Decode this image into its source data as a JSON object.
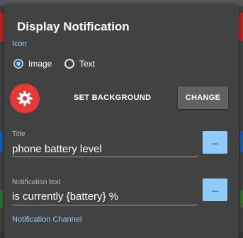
{
  "dialog": {
    "title": "Display Notification",
    "icon_section_label": "Icon",
    "icon_options": [
      {
        "label": "Image",
        "selected": true
      },
      {
        "label": "Text",
        "selected": false
      }
    ],
    "icon_image": "gear-icon",
    "set_background_label": "SET BACKGROUND",
    "change_label": "CHANGE",
    "title_field": {
      "label": "Title",
      "value": "phone battery level"
    },
    "text_field": {
      "label": "Notification text",
      "value": "is currently {battery} %"
    },
    "dots_label": "...",
    "channel_label": "Notification Channel"
  },
  "colors": {
    "accent": "#90caf9",
    "gear_bg": "#e53935",
    "dialog_bg": "#424242"
  }
}
